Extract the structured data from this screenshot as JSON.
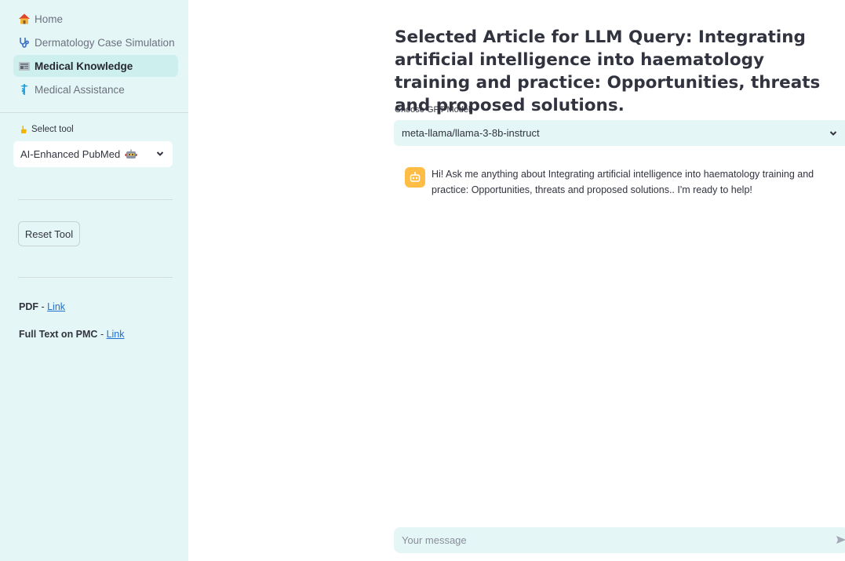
{
  "sidebar": {
    "nav": [
      {
        "label": "Home",
        "icon": "house-icon",
        "active": false
      },
      {
        "label": "Dermatology Case Simulation",
        "icon": "stethoscope-icon",
        "active": false
      },
      {
        "label": "Medical Knowledge",
        "icon": "newspaper-icon",
        "active": true
      },
      {
        "label": "Medical Assistance",
        "icon": "caduceus-icon",
        "active": false
      }
    ],
    "select_tool": {
      "label": "Select tool",
      "icon": "pointing-hand-icon",
      "value": "AI-Enhanced PubMed",
      "value_icon": "robot-icon"
    },
    "reset_button": "Reset Tool",
    "links": [
      {
        "prefix": "PDF",
        "sep": " - ",
        "link": "Link"
      },
      {
        "prefix": "Full Text on PMC",
        "sep": " - ",
        "link": "Link"
      }
    ]
  },
  "main": {
    "title": "Selected Article for LLM Query: Integrating artificial intelligence into haematology training and practice: Opportunities, threats and proposed solutions.",
    "model_label": "Choose GPT Model",
    "model_value": "meta-llama/llama-3-8b-instruct",
    "assistant_message": "Hi! Ask me anything about Integrating artificial intelligence into haematology training and practice: Opportunities, threats and proposed solutions.. I'm ready to help!",
    "assistant_avatar": "bot-icon",
    "chat_placeholder": "Your message",
    "send_icon": "send-icon"
  },
  "colors": {
    "sidebar_bg": "#e4f7f6",
    "active_nav_bg": "#cdf0ee",
    "link": "#1f6fd1",
    "avatar": "#ffbd45"
  }
}
